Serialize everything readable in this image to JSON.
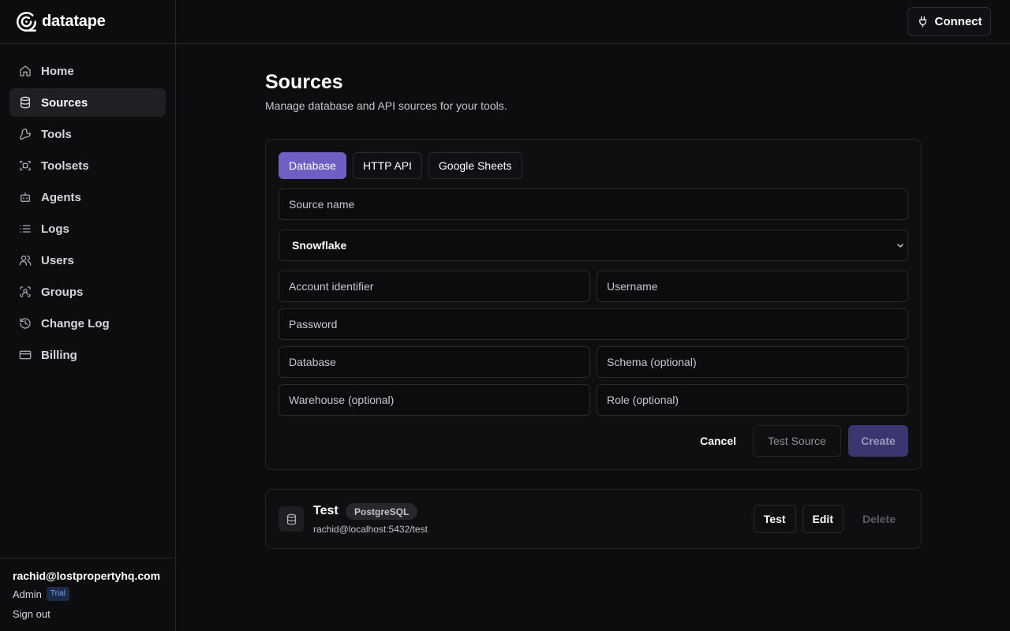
{
  "app": {
    "name": "datatape"
  },
  "topbar": {
    "connect_label": "Connect"
  },
  "sidebar": {
    "items": [
      {
        "label": "Home",
        "icon": "home-icon",
        "active": false
      },
      {
        "label": "Sources",
        "icon": "database-icon",
        "active": true
      },
      {
        "label": "Tools",
        "icon": "wrench-icon",
        "active": false
      },
      {
        "label": "Toolsets",
        "icon": "toolsets-icon",
        "active": false
      },
      {
        "label": "Agents",
        "icon": "bot-icon",
        "active": false
      },
      {
        "label": "Logs",
        "icon": "list-icon",
        "active": false
      },
      {
        "label": "Users",
        "icon": "users-icon",
        "active": false
      },
      {
        "label": "Groups",
        "icon": "groups-icon",
        "active": false
      },
      {
        "label": "Change Log",
        "icon": "history-icon",
        "active": false
      },
      {
        "label": "Billing",
        "icon": "credit-card-icon",
        "active": false
      }
    ]
  },
  "user": {
    "email": "rachid@lostpropertyhq.com",
    "role": "Admin",
    "plan_badge": "Trial",
    "sign_out_label": "Sign out"
  },
  "page": {
    "title": "Sources",
    "subtitle": "Manage database and API sources for your tools."
  },
  "form": {
    "tabs": [
      {
        "label": "Database",
        "active": true
      },
      {
        "label": "HTTP API",
        "active": false
      },
      {
        "label": "Google Sheets",
        "active": false
      }
    ],
    "source_name_placeholder": "Source name",
    "db_type_selected": "Snowflake",
    "account_identifier_placeholder": "Account identifier",
    "username_placeholder": "Username",
    "password_placeholder": "Password",
    "database_placeholder": "Database",
    "schema_placeholder": "Schema (optional)",
    "warehouse_placeholder": "Warehouse (optional)",
    "role_placeholder": "Role (optional)",
    "cancel_label": "Cancel",
    "test_source_label": "Test Source",
    "create_label": "Create"
  },
  "sources": [
    {
      "name": "Test",
      "type_badge": "PostgreSQL",
      "connection": "rachid@localhost:5432/test",
      "test_label": "Test",
      "edit_label": "Edit",
      "delete_label": "Delete"
    }
  ],
  "colors": {
    "background": "#0d0d10",
    "accent": "#6e5fc4",
    "create_button_disabled": "#3b3670",
    "trial_badge_bg": "#1b2a4a",
    "trial_badge_text": "#7ea4f0"
  }
}
